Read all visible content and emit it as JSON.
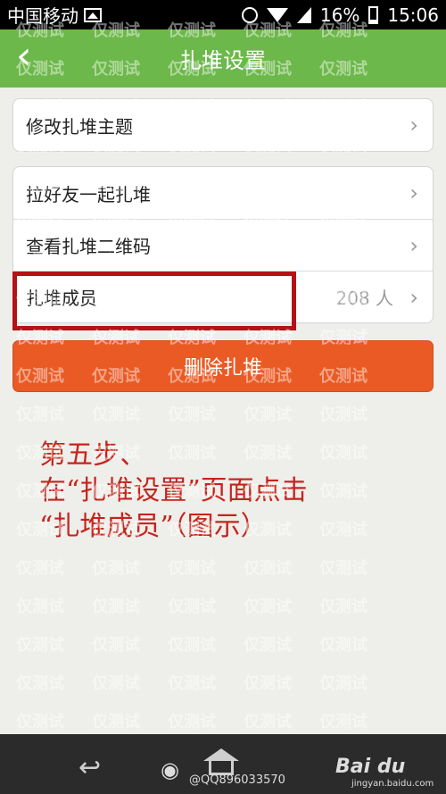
{
  "statusbar": {
    "carrier": "中国移动",
    "battery_percent": "16%",
    "time": "15:06",
    "icons": [
      "image-icon",
      "alarm-icon",
      "wifi-icon",
      "signal-icon",
      "battery-icon"
    ]
  },
  "navbar": {
    "back_icon": "‹",
    "title": "扎堆设置"
  },
  "settings": {
    "item_topic": "修改扎堆主题",
    "item_invite": "拉好友一起扎堆",
    "item_qrcode": "查看扎堆二维码",
    "item_members": "扎堆成员",
    "members_count": "208 人"
  },
  "delete_button": "删除扎堆",
  "instruction": {
    "line1": "第五步、",
    "line2": "在“扎堆设置”页面点击",
    "line3": "“扎堆成员”（图示）"
  },
  "watermark_text": "仅测试",
  "footer": {
    "credit": "@QQ896033570",
    "baidu": "Bai du",
    "baidu_sub": "jingyan.baidu.com"
  },
  "colors": {
    "nav_green": "#6cb84a",
    "delete_orange": "#ea5a24",
    "annotation_red": "#c5241c"
  }
}
